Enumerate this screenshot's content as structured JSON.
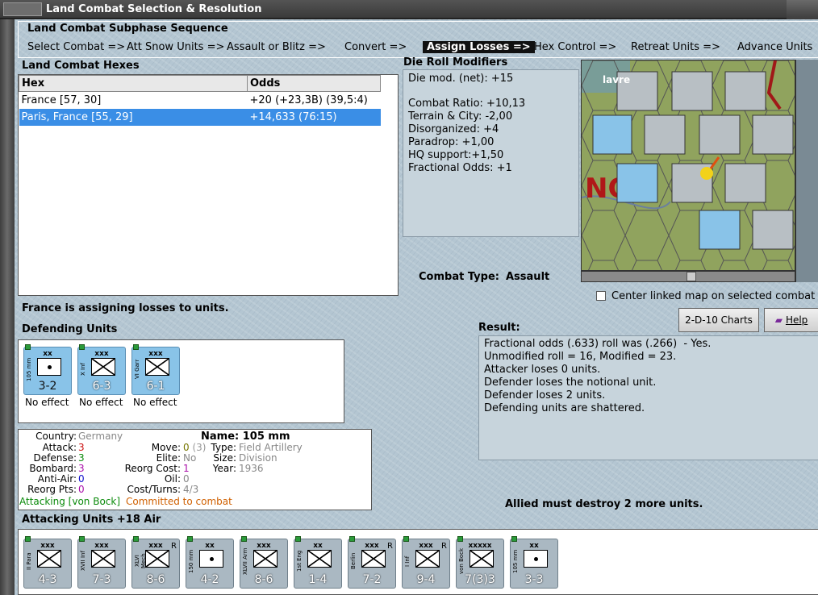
{
  "window": {
    "title": "Land Combat Selection & Resolution"
  },
  "sequence": {
    "title": "Land Combat Subphase Sequence",
    "steps": [
      "Select Combat =>",
      "Att Snow Units =>",
      "Assault or Blitz =>",
      "Convert =>",
      "Assign Losses =>",
      "Hex Control =>",
      "Retreat Units =>",
      "Advance Units"
    ],
    "active_index": 4
  },
  "hexes": {
    "title": "Land Combat Hexes",
    "col_hex": "Hex",
    "col_odds": "Odds",
    "rows": [
      {
        "hex": "France [57, 30]",
        "odds": "+20 (+23,3B) (39,5:4)"
      },
      {
        "hex": "Paris, France [55, 29]",
        "odds": "+14,633 (76:15)"
      }
    ]
  },
  "modifiers": {
    "title": "Die Roll Modifiers",
    "net": "Die mod. (net): +15",
    "lines": [
      "Combat Ratio: +10,13",
      "Terrain & City: -2,00",
      "Disorganized: +4",
      "Paradrop: +1,00",
      "HQ support:+1,50",
      "Fractional Odds: +1"
    ]
  },
  "combat_type": {
    "label": "Combat Type:",
    "value": "Assault"
  },
  "center_map": {
    "label": "Center linked map on selected combat",
    "checked": false
  },
  "buttons": {
    "charts": "2-D-10 Charts",
    "help": "Help"
  },
  "status": "France is assigning losses to units.",
  "defending": {
    "title": "Defending Units",
    "units": [
      {
        "size": "xx",
        "name": "105 mm",
        "value": "3-2",
        "effect": "No effect"
      },
      {
        "size": "xxx",
        "name": "X Inf",
        "value": "6-3",
        "effect": "No effect"
      },
      {
        "size": "xxx",
        "name": "VI Garr",
        "value": "6-1",
        "effect": "No effect"
      }
    ]
  },
  "result": {
    "title": "Result:",
    "lines": [
      "Fractional odds (.633) roll was (.266)  - Yes.",
      "Unmodified roll = 16, Modified = 23.",
      "Attacker loses 0 units.",
      "Defender loses the notional unit.",
      "Defender loses 2 units.",
      "Defending units are shattered."
    ]
  },
  "allied_msg": "Allied must destroy 2 more units.",
  "unitinfo": {
    "country_l": "Country:",
    "country": "Germany",
    "name_l": "Name:",
    "name": "105 mm",
    "attack_l": "Attack:",
    "attack": "3",
    "move_l": "Move:",
    "move": "0",
    "move2": "(3)",
    "type_l": "Type:",
    "type": "Field Artillery",
    "defense_l": "Defense:",
    "defense": "3",
    "elite_l": "Elite:",
    "elite": "No",
    "size_l": "Size:",
    "size": "Division",
    "bombard_l": "Bombard:",
    "bombard": "3",
    "reorgcost_l": "Reorg Cost:",
    "reorgcost": "1",
    "year_l": "Year:",
    "year": "1936",
    "antiair_l": "Anti-Air:",
    "antiair": "0",
    "oil_l": "Oil:",
    "oil": "0",
    "reorgpts_l": "Reorg Pts:",
    "reorgpts": "0",
    "costturns_l": "Cost/Turns:",
    "costturns": "4/3",
    "attacking": "Attacking [von Bock]",
    "committed": "Committed to combat"
  },
  "attacking": {
    "title": "Attacking Units +18 Air",
    "units": [
      {
        "size": "xxx",
        "name": "II Para",
        "value": "4-3"
      },
      {
        "size": "xxx",
        "name": "XVII Inf",
        "value": "7-3"
      },
      {
        "size": "xxx",
        "name": "XLVI Mech",
        "value": "8-6",
        "r": "R"
      },
      {
        "size": "xx",
        "name": "150 mm",
        "value": "4-2"
      },
      {
        "size": "xxx",
        "name": "XLVII Arm",
        "value": "8-6"
      },
      {
        "size": "xx",
        "name": "1st Eng",
        "value": "1-4"
      },
      {
        "size": "xxx",
        "name": "Berlin",
        "value": "7-2",
        "r": "R"
      },
      {
        "size": "xxx",
        "name": "I Inf",
        "value": "9-4",
        "r": "R"
      },
      {
        "size": "xxxxx",
        "name": "von Bock",
        "value": "7(3)3"
      },
      {
        "size": "xx",
        "name": "105 mm",
        "value": "3-3"
      }
    ]
  },
  "map": {
    "label": "lavre"
  }
}
